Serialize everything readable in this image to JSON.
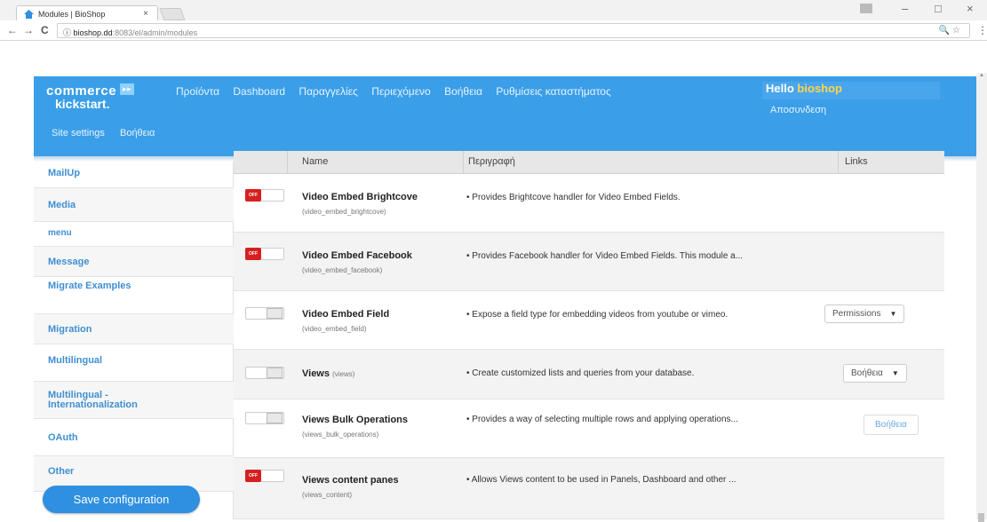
{
  "browser": {
    "tab_title": "Modules | BioShop",
    "tab_close": "×",
    "url_host": "bioshop.dd",
    "url_rest": ":8083/el/admin/modules",
    "url_info": "ⓘ",
    "back": "←",
    "forward": "→",
    "reload": "C",
    "minimize": "–",
    "maximize": "□",
    "close": "×",
    "zoom_icon": "🔍",
    "star_icon": "☆",
    "menu_icon": "⋮"
  },
  "header": {
    "logo_line1": "commerce",
    "logo_line2": "kickstart.",
    "logo_badge": "▸▸",
    "nav": [
      "Προϊόντα",
      "Dashboard",
      "Παραγγελίες",
      "Περιεχόμενο",
      "Βοήθεια",
      "Ρυθμίσεις καταστήματος"
    ],
    "hello_prefix": "Hello ",
    "hello_user": "bioshop",
    "logout": "Αποσυνδεση",
    "subnav": [
      "Site settings",
      "Βοήθεια"
    ]
  },
  "sidebar": {
    "items": [
      "MailUp",
      "Media",
      "menu",
      "Message",
      "Migrate Examples",
      "Migration",
      "Multilingual",
      "Multilingual - Internationalization",
      "OAuth",
      "Other"
    ],
    "save_label": "Save configuration"
  },
  "table": {
    "headers": {
      "name": "Name",
      "description": "Περιγραφή",
      "links": "Links"
    },
    "off_label": "OFF",
    "rows": [
      {
        "name": "Video Embed Brightcove",
        "machine": "(video_embed_brightcove)",
        "desc": "• Provides Brightcove handler for Video Embed Fields.",
        "enabled": false,
        "link": ""
      },
      {
        "name": "Video Embed Facebook",
        "machine": "(video_embed_facebook)",
        "desc": "• Provides Facebook handler for Video Embed Fields. This module a...",
        "enabled": false,
        "link": ""
      },
      {
        "name": "Video Embed Field",
        "machine": "(video_embed_field)",
        "desc": "• Expose a field type for embedding videos from youtube or vimeo.",
        "enabled": true,
        "link": "Permissions"
      },
      {
        "name": "Views",
        "machine": "(views)",
        "desc": "• Create customized lists and queries from your database.",
        "enabled": true,
        "link": "Βοήθεια"
      },
      {
        "name": "Views Bulk Operations",
        "machine": "(views_bulk_operations)",
        "desc": "• Provides a way of selecting multiple rows and applying operations...",
        "enabled": true,
        "link": "Βοήθεια"
      },
      {
        "name": "Views content panes",
        "machine": "(views_content)",
        "desc": "• Allows Views content to be used in Panels, Dashboard and other ...",
        "enabled": false,
        "link": ""
      }
    ]
  },
  "colors": {
    "header": "#3a9ee8",
    "accent": "#2f8fe0",
    "off": "#d62020",
    "sidebar_link": "#3f8fd2"
  }
}
